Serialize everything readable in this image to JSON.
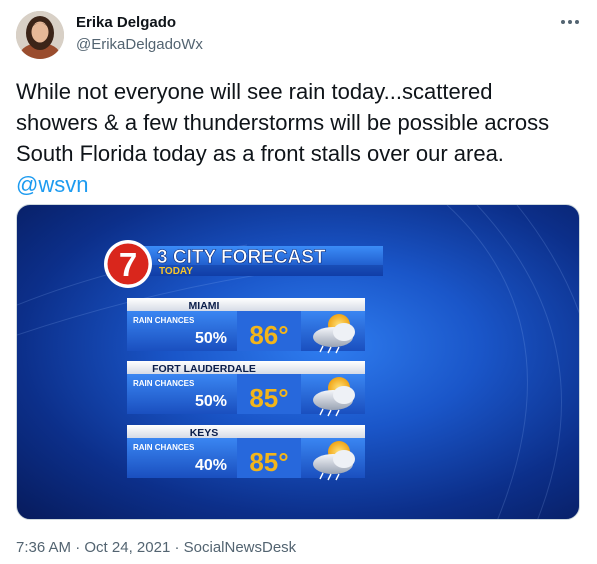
{
  "tweet": {
    "display_name": "Erika Delgado",
    "handle": "@ErikaDelgadoWx",
    "text_line1": "While not everyone will see rain today...scattered",
    "text_line2": "showers & a few thunderstorms will be possible across",
    "text_line3": "South Florida today as a front stalls over our area.",
    "mention": "@wsvn",
    "time": "7:36 AM",
    "date": "Oct 24, 2021",
    "separator": "·",
    "source": "SocialNewsDesk"
  },
  "graphic": {
    "logo_number": "7",
    "title": "3 CITY FORECAST",
    "subtitle": "TODAY",
    "cities": [
      {
        "name": "MIAMI",
        "rain_label": "RAIN CHANCES",
        "rain_value": "50%",
        "temp": "86°",
        "icon": "partly-cloudy-rain-icon"
      },
      {
        "name": "FORT LAUDERDALE",
        "rain_label": "RAIN CHANCES",
        "rain_value": "50%",
        "temp": "85°",
        "icon": "partly-cloudy-rain-icon"
      },
      {
        "name": "KEYS",
        "rain_label": "RAIN CHANCES",
        "rain_value": "40%",
        "temp": "85°",
        "icon": "partly-cloudy-rain-icon"
      }
    ]
  },
  "colors": {
    "link": "#1d9bf0",
    "secondary_text": "#536471",
    "temp_gold": "#f2b51b",
    "panel_blue": "#1f5fd6"
  }
}
